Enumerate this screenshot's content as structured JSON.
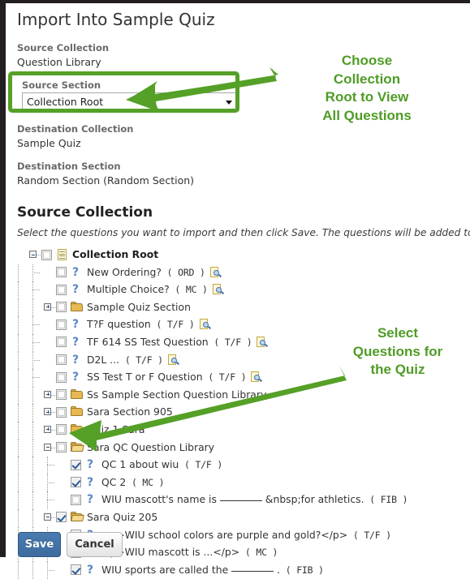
{
  "page": {
    "title": "Import Into Sample Quiz"
  },
  "fields": {
    "source_collection_label": "Source Collection",
    "source_collection_value": "Question Library",
    "source_section_label": "Source Section",
    "source_section_value": "Collection Root",
    "source_section_options": [
      "Collection Root"
    ],
    "destination_collection_label": "Destination Collection",
    "destination_collection_value": "Sample Quiz",
    "destination_section_label": "Destination Section",
    "destination_section_value": "Random Section (Random Section)"
  },
  "source_collection": {
    "heading": "Source Collection",
    "help_text": "Select the questions you want to import and then click Save. The questions will be added to the list"
  },
  "tree": [
    {
      "depth": 0,
      "toggle": "minus",
      "checkbox": "unchecked",
      "icon": "document-icon",
      "label": "Collection Root",
      "bold": true,
      "qtype": "",
      "preview": false
    },
    {
      "depth": 1,
      "toggle": "none",
      "checkbox": "unchecked",
      "icon": "question-icon",
      "label": "New Ordering?",
      "bold": false,
      "qtype": "( ORD )",
      "preview": true
    },
    {
      "depth": 1,
      "toggle": "none",
      "checkbox": "unchecked",
      "icon": "question-icon",
      "label": "Multiple Choice?",
      "bold": false,
      "qtype": "( MC )",
      "preview": true
    },
    {
      "depth": 1,
      "toggle": "plus",
      "checkbox": "unchecked",
      "icon": "folder-icon",
      "label": "Sample Quiz Section",
      "bold": false,
      "qtype": "",
      "preview": false
    },
    {
      "depth": 1,
      "toggle": "none",
      "checkbox": "unchecked",
      "icon": "question-icon",
      "label": "T?F question",
      "bold": false,
      "qtype": "( T/F )",
      "preview": true
    },
    {
      "depth": 1,
      "toggle": "none",
      "checkbox": "unchecked",
      "icon": "question-icon",
      "label": "TF 614 SS Test Question",
      "bold": false,
      "qtype": "( T/F )",
      "preview": true
    },
    {
      "depth": 1,
      "toggle": "none",
      "checkbox": "unchecked",
      "icon": "question-icon",
      "label": "D2L ...",
      "bold": false,
      "qtype": "( T/F )",
      "preview": true
    },
    {
      "depth": 1,
      "toggle": "none",
      "checkbox": "unchecked",
      "icon": "question-icon",
      "label": "SS Test T or F Question",
      "bold": false,
      "qtype": "( T/F )",
      "preview": true
    },
    {
      "depth": 1,
      "toggle": "plus",
      "checkbox": "unchecked",
      "icon": "folder-icon",
      "label": "Ss Sample Section Question Library",
      "bold": false,
      "qtype": "",
      "preview": false
    },
    {
      "depth": 1,
      "toggle": "plus",
      "checkbox": "unchecked",
      "icon": "folder-icon",
      "label": "Sara Section 905",
      "bold": false,
      "qtype": "",
      "preview": false
    },
    {
      "depth": 1,
      "toggle": "plus",
      "checkbox": "unchecked",
      "icon": "folder-icon",
      "label": "Quiz 1 Sara",
      "bold": false,
      "qtype": "",
      "preview": false
    },
    {
      "depth": 1,
      "toggle": "minus",
      "checkbox": "unchecked",
      "icon": "folder-open-icon",
      "label": "Sara QC Question Library",
      "bold": false,
      "qtype": "",
      "preview": false
    },
    {
      "depth": 2,
      "toggle": "none",
      "checkbox": "checked",
      "icon": "question-icon",
      "label": "QC 1 about wiu",
      "bold": false,
      "qtype": "( T/F )",
      "preview": false
    },
    {
      "depth": 2,
      "toggle": "none",
      "checkbox": "checked",
      "icon": "question-icon",
      "label": "QC 2",
      "bold": false,
      "qtype": "( MC )",
      "preview": false
    },
    {
      "depth": 2,
      "toggle": "none",
      "checkbox": "unchecked",
      "icon": "question-icon",
      "label": "WIU mascott's name is ______ &nbsp;for athletics.",
      "bold": false,
      "qtype": "( FIB )",
      "preview": false
    },
    {
      "depth": 1,
      "toggle": "minus",
      "checkbox": "checked",
      "icon": "folder-open-icon",
      "label": "Sara Quiz 205",
      "bold": false,
      "qtype": "",
      "preview": false
    },
    {
      "depth": 2,
      "toggle": "none",
      "checkbox": "checked",
      "icon": "question-icon",
      "label": "<p>WIU school colors are purple and gold?</p>",
      "bold": false,
      "qtype": "( T/F )",
      "preview": false
    },
    {
      "depth": 2,
      "toggle": "none",
      "checkbox": "checked",
      "icon": "question-icon",
      "label": "<p>WIU mascott is ...</p>",
      "bold": false,
      "qtype": "( MC )",
      "preview": false
    },
    {
      "depth": 2,
      "toggle": "none",
      "checkbox": "checked",
      "icon": "question-icon",
      "label": "WIU sports are called the ______ .",
      "bold": false,
      "qtype": "( FIB )",
      "preview": false
    }
  ],
  "footer": {
    "save_label": "Save",
    "cancel_label": "Cancel"
  },
  "annotations": {
    "first": "Choose\nCollection\nRoot to View\nAll Questions",
    "second": "Select\nQuestions for\nthe Quiz",
    "color": "#4e9c25"
  }
}
